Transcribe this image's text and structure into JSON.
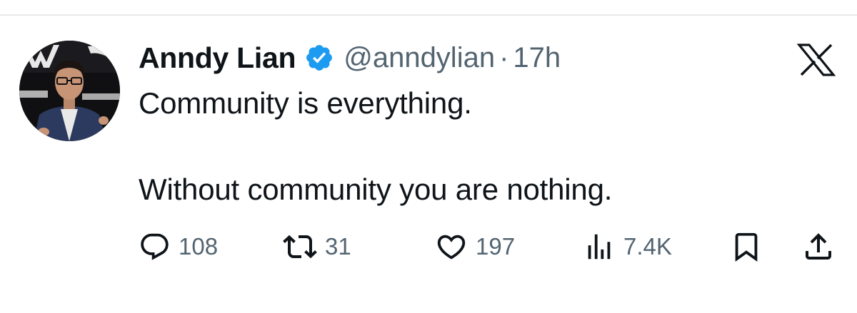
{
  "tweet": {
    "display_name": "Anndy Lian",
    "handle": "@anndylian",
    "separator": "·",
    "time": "17h",
    "text_lines": [
      "Community is everything.",
      "Without community you are nothing."
    ]
  },
  "actions": {
    "replies": "108",
    "reposts": "31",
    "likes": "197",
    "views": "7.4K"
  },
  "icons": {
    "verified": "verified-badge-icon",
    "platform": "x-logo-icon",
    "reply": "reply-icon",
    "repost": "repost-icon",
    "like": "heart-icon",
    "views": "views-icon",
    "bookmark": "bookmark-icon",
    "share": "share-icon"
  },
  "colors": {
    "verified": "#1d9bf0",
    "text": "#0f1419",
    "secondary": "#536471"
  }
}
